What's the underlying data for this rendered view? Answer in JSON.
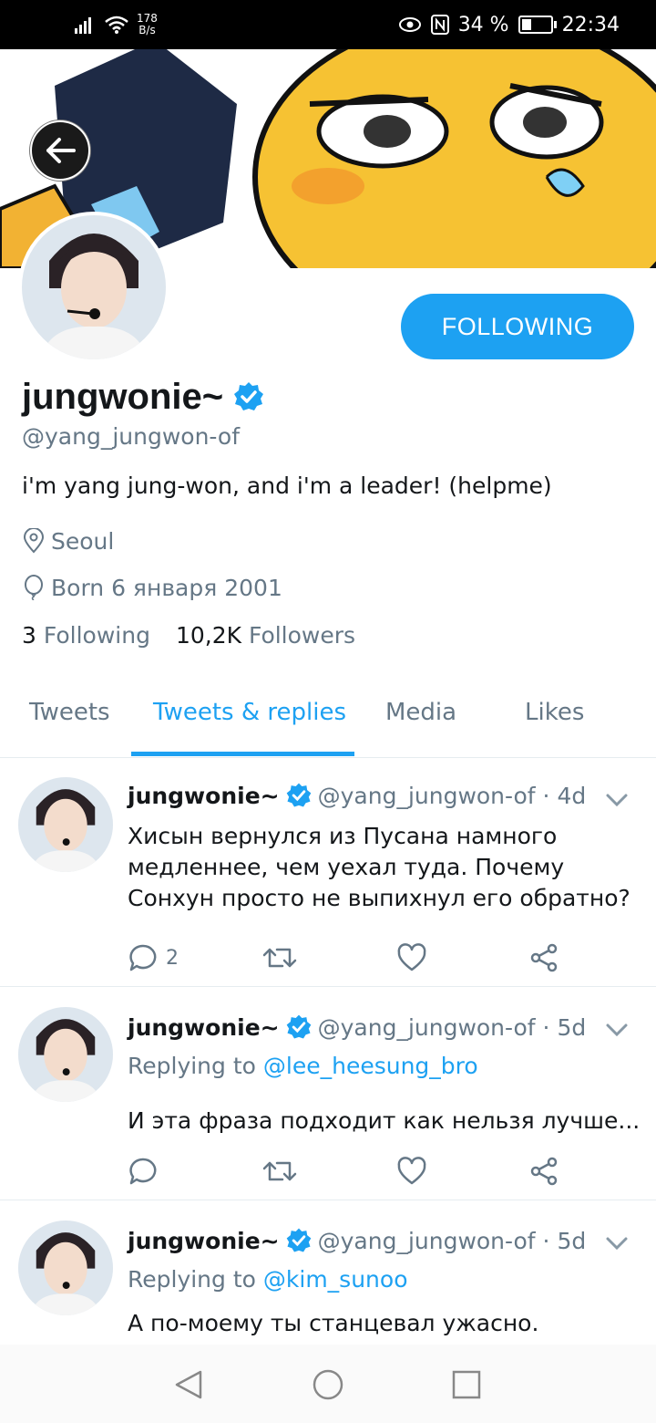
{
  "status_bar": {
    "speed_value": "178",
    "speed_unit": "B/s",
    "battery": "34 %",
    "time": "22:34"
  },
  "profile": {
    "display_name": "jungwonie~",
    "handle": "@yang_jungwon-of",
    "bio": "i'm yang jung-won, and i'm a leader! (helpme)",
    "location": "Seoul",
    "birthday": "Born 6 января 2001",
    "following_count": "3",
    "following_label": "Following",
    "followers_count": "10,2K",
    "followers_label": "Followers",
    "follow_button": "FOLLOWING",
    "accent_color": "#1da1f2"
  },
  "tabs": [
    {
      "label": "Tweets",
      "active": false
    },
    {
      "label": "Tweets & replies",
      "active": true
    },
    {
      "label": "Media",
      "active": false
    },
    {
      "label": "Likes",
      "active": false
    }
  ],
  "tweets": [
    {
      "name": "jungwonie~",
      "handle_time": "@yang_jungwon-of · 4d",
      "text": "Хисын вернулся из Пусана намного медленнее, чем уехал туда. Почему Сонхун просто не выпихнул его обратно?",
      "reply_count": "2"
    },
    {
      "name": "jungwonie~",
      "handle_time": "@yang_jungwon-of · 5d",
      "replying_prefix": "Replying to",
      "replying_to": "@lee_heesung_bro",
      "text": "И эта фраза подходит как нельзя лучше..."
    },
    {
      "name": "jungwonie~",
      "handle_time": "@yang_jungwon-of · 5d",
      "replying_prefix": "Replying to",
      "replying_to": "@kim_sunoo",
      "text": "А по-моему ты станцевал ужасно."
    }
  ],
  "icons": [
    "signal-icon",
    "wifi-icon",
    "eye-icon",
    "nfc-icon",
    "battery-icon",
    "back-arrow-icon",
    "verified-icon",
    "location-icon",
    "balloon-icon",
    "reply-icon",
    "retweet-icon",
    "like-icon",
    "share-icon",
    "chevron-down-icon",
    "nav-back-icon",
    "nav-home-icon",
    "nav-recents-icon"
  ]
}
